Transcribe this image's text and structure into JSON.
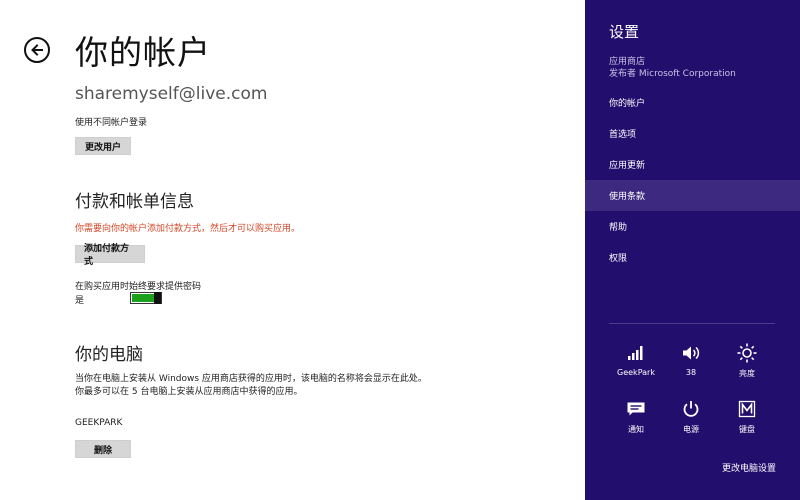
{
  "main": {
    "title": "你的帐户",
    "email": "sharemyself@live.com",
    "switch_hint": "使用不同帐户登录",
    "change_user_label": "更改用户",
    "payment": {
      "heading": "付款和帐单信息",
      "warning": "你需要向你的帐户添加付款方式，然后才可以购买应用。",
      "add_label": "添加付款方式",
      "password_prompt": "在购买应用时始终要求提供密码",
      "toggle_state": "是",
      "toggle_on": true
    },
    "pc": {
      "heading": "你的电脑",
      "description": "当你在电脑上安装从 Windows 应用商店获得的应用时，该电脑的名称将会显示在此处。你最多可以在 5 台电脑上安装从应用商店中获得的应用。",
      "name": "GEEKPARK",
      "remove_label": "删除"
    }
  },
  "charm": {
    "title": "设置",
    "app": "应用商店",
    "publisher": "发布者 Microsoft Corporation",
    "menu": [
      "你的帐户",
      "首选项",
      "应用更新",
      "使用条款",
      "帮助",
      "权限"
    ],
    "active_item": "使用条款",
    "tiles": [
      {
        "label": "GeekPark",
        "icon": "wifi-signal-icon"
      },
      {
        "label": "38",
        "icon": "volume-icon"
      },
      {
        "label": "亮度",
        "icon": "brightness-icon"
      },
      {
        "label": "通知",
        "icon": "notifications-icon"
      },
      {
        "label": "电源",
        "icon": "power-icon"
      },
      {
        "label": "键盘",
        "icon": "keyboard-icon"
      }
    ],
    "change_pc_settings": "更改电脑设置"
  },
  "colors": {
    "charm_bg": "#220e6c",
    "charm_active": "#3d2a80",
    "warning": "#d24726",
    "toggle_on": "#1ba11b"
  }
}
